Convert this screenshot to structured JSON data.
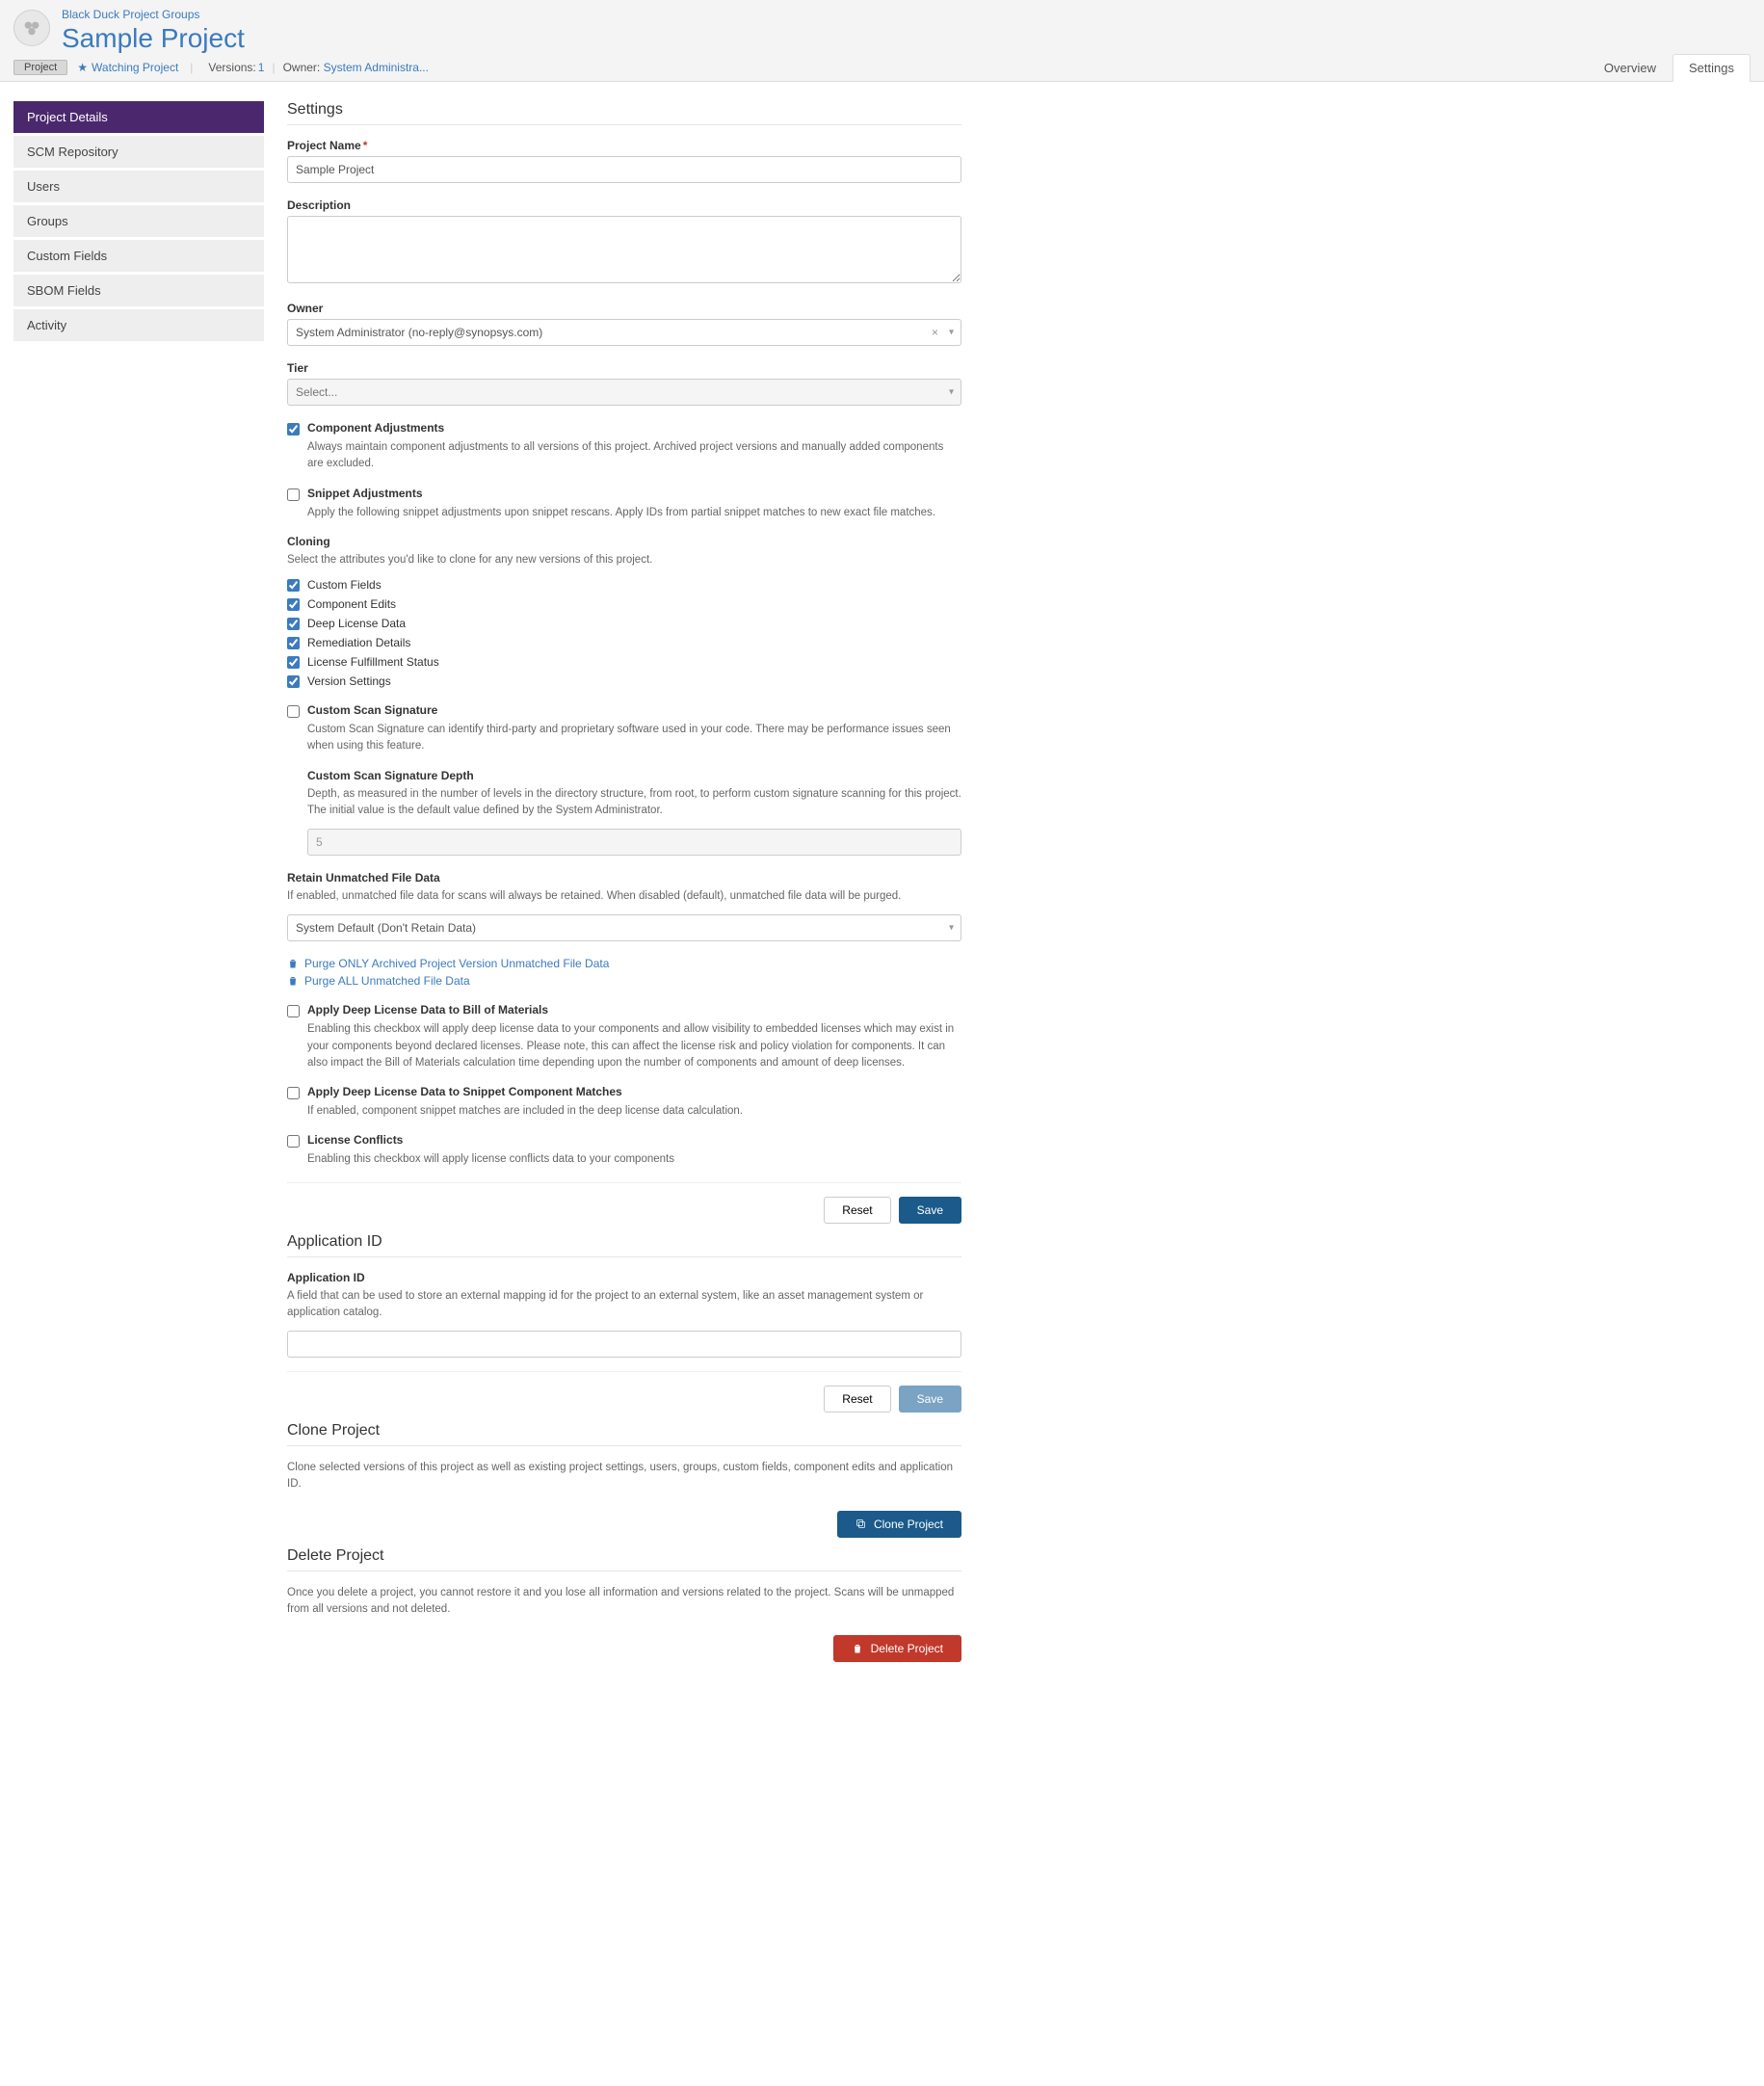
{
  "header": {
    "breadcrumb": "Black Duck Project Groups",
    "project_title": "Sample Project",
    "project_button": "Project",
    "watching": "Watching Project",
    "versions_label": "Versions:",
    "versions_count": "1",
    "owner_label": "Owner:",
    "owner_value": "System Administra...",
    "tabs": {
      "overview": "Overview",
      "settings": "Settings"
    }
  },
  "sidenav": [
    "Project Details",
    "SCM Repository",
    "Users",
    "Groups",
    "Custom Fields",
    "SBOM Fields",
    "Activity"
  ],
  "settings": {
    "heading": "Settings",
    "project_name_label": "Project Name",
    "project_name_value": "Sample Project",
    "description_label": "Description",
    "owner_label": "Owner",
    "owner_value": "System Administrator (no-reply@synopsys.com)",
    "tier_label": "Tier",
    "tier_placeholder": "Select...",
    "component_adj": {
      "label": "Component Adjustments",
      "help": "Always maintain component adjustments to all versions of this project. Archived project versions and manually added components are excluded.",
      "checked": true
    },
    "snippet_adj": {
      "label": "Snippet Adjustments",
      "help": "Apply the following snippet adjustments upon snippet rescans. Apply IDs from partial snippet matches to new exact file matches.",
      "checked": false
    },
    "cloning_h": "Cloning",
    "cloning_help": "Select the attributes you'd like to clone for any new versions of this project.",
    "clone_opts": [
      {
        "label": "Custom Fields",
        "checked": true
      },
      {
        "label": "Component Edits",
        "checked": true
      },
      {
        "label": "Deep License Data",
        "checked": true
      },
      {
        "label": "Remediation Details",
        "checked": true
      },
      {
        "label": "License Fulfillment Status",
        "checked": true
      },
      {
        "label": "Version Settings",
        "checked": true
      }
    ],
    "custom_sig": {
      "label": "Custom Scan Signature",
      "help": "Custom Scan Signature can identify third-party and proprietary software used in your code. There may be performance issues seen when using this feature.",
      "depth_label": "Custom Scan Signature Depth",
      "depth_help": "Depth, as measured in the number of levels in the directory structure, from root, to perform custom signature scanning for this project. The initial value is the default value defined by the System Administrator.",
      "depth_value": "5"
    },
    "retain": {
      "label": "Retain Unmatched File Data",
      "help": "If enabled, unmatched file data for scans will always be retained. When disabled (default), unmatched file data will be purged.",
      "value": "System Default (Don't Retain Data)"
    },
    "purge_archived": "Purge ONLY Archived Project Version Unmatched File Data",
    "purge_all": "Purge ALL Unmatched File Data",
    "deep_bom": {
      "label": "Apply Deep License Data to Bill of Materials",
      "help": "Enabling this checkbox will apply deep license data to your components and allow visibility to embedded licenses which may exist in your components beyond declared licenses. Please note, this can affect the license risk and policy violation for components. It can also impact the Bill of Materials calculation time depending upon the number of components and amount of deep licenses."
    },
    "deep_snippet": {
      "label": "Apply Deep License Data to Snippet Component Matches",
      "help": "If enabled, component snippet matches are included in the deep license data calculation."
    },
    "lic_conflicts": {
      "label": "License Conflicts",
      "help": "Enabling this checkbox will apply license conflicts data to your components"
    },
    "btn_reset": "Reset",
    "btn_save": "Save"
  },
  "app_id": {
    "heading": "Application ID",
    "label": "Application ID",
    "help": "A field that can be used to store an external mapping id for the project to an external system, like an asset management system or application catalog.",
    "btn_reset": "Reset",
    "btn_save": "Save"
  },
  "clone_project": {
    "heading": "Clone Project",
    "help": "Clone selected versions of this project as well as existing project settings, users, groups, custom fields, component edits and application ID.",
    "btn": "Clone Project"
  },
  "delete_project": {
    "heading": "Delete Project",
    "help": "Once you delete a project, you cannot restore it and you lose all information and versions related to the project. Scans will be unmapped from all versions and not deleted.",
    "btn": "Delete Project"
  }
}
